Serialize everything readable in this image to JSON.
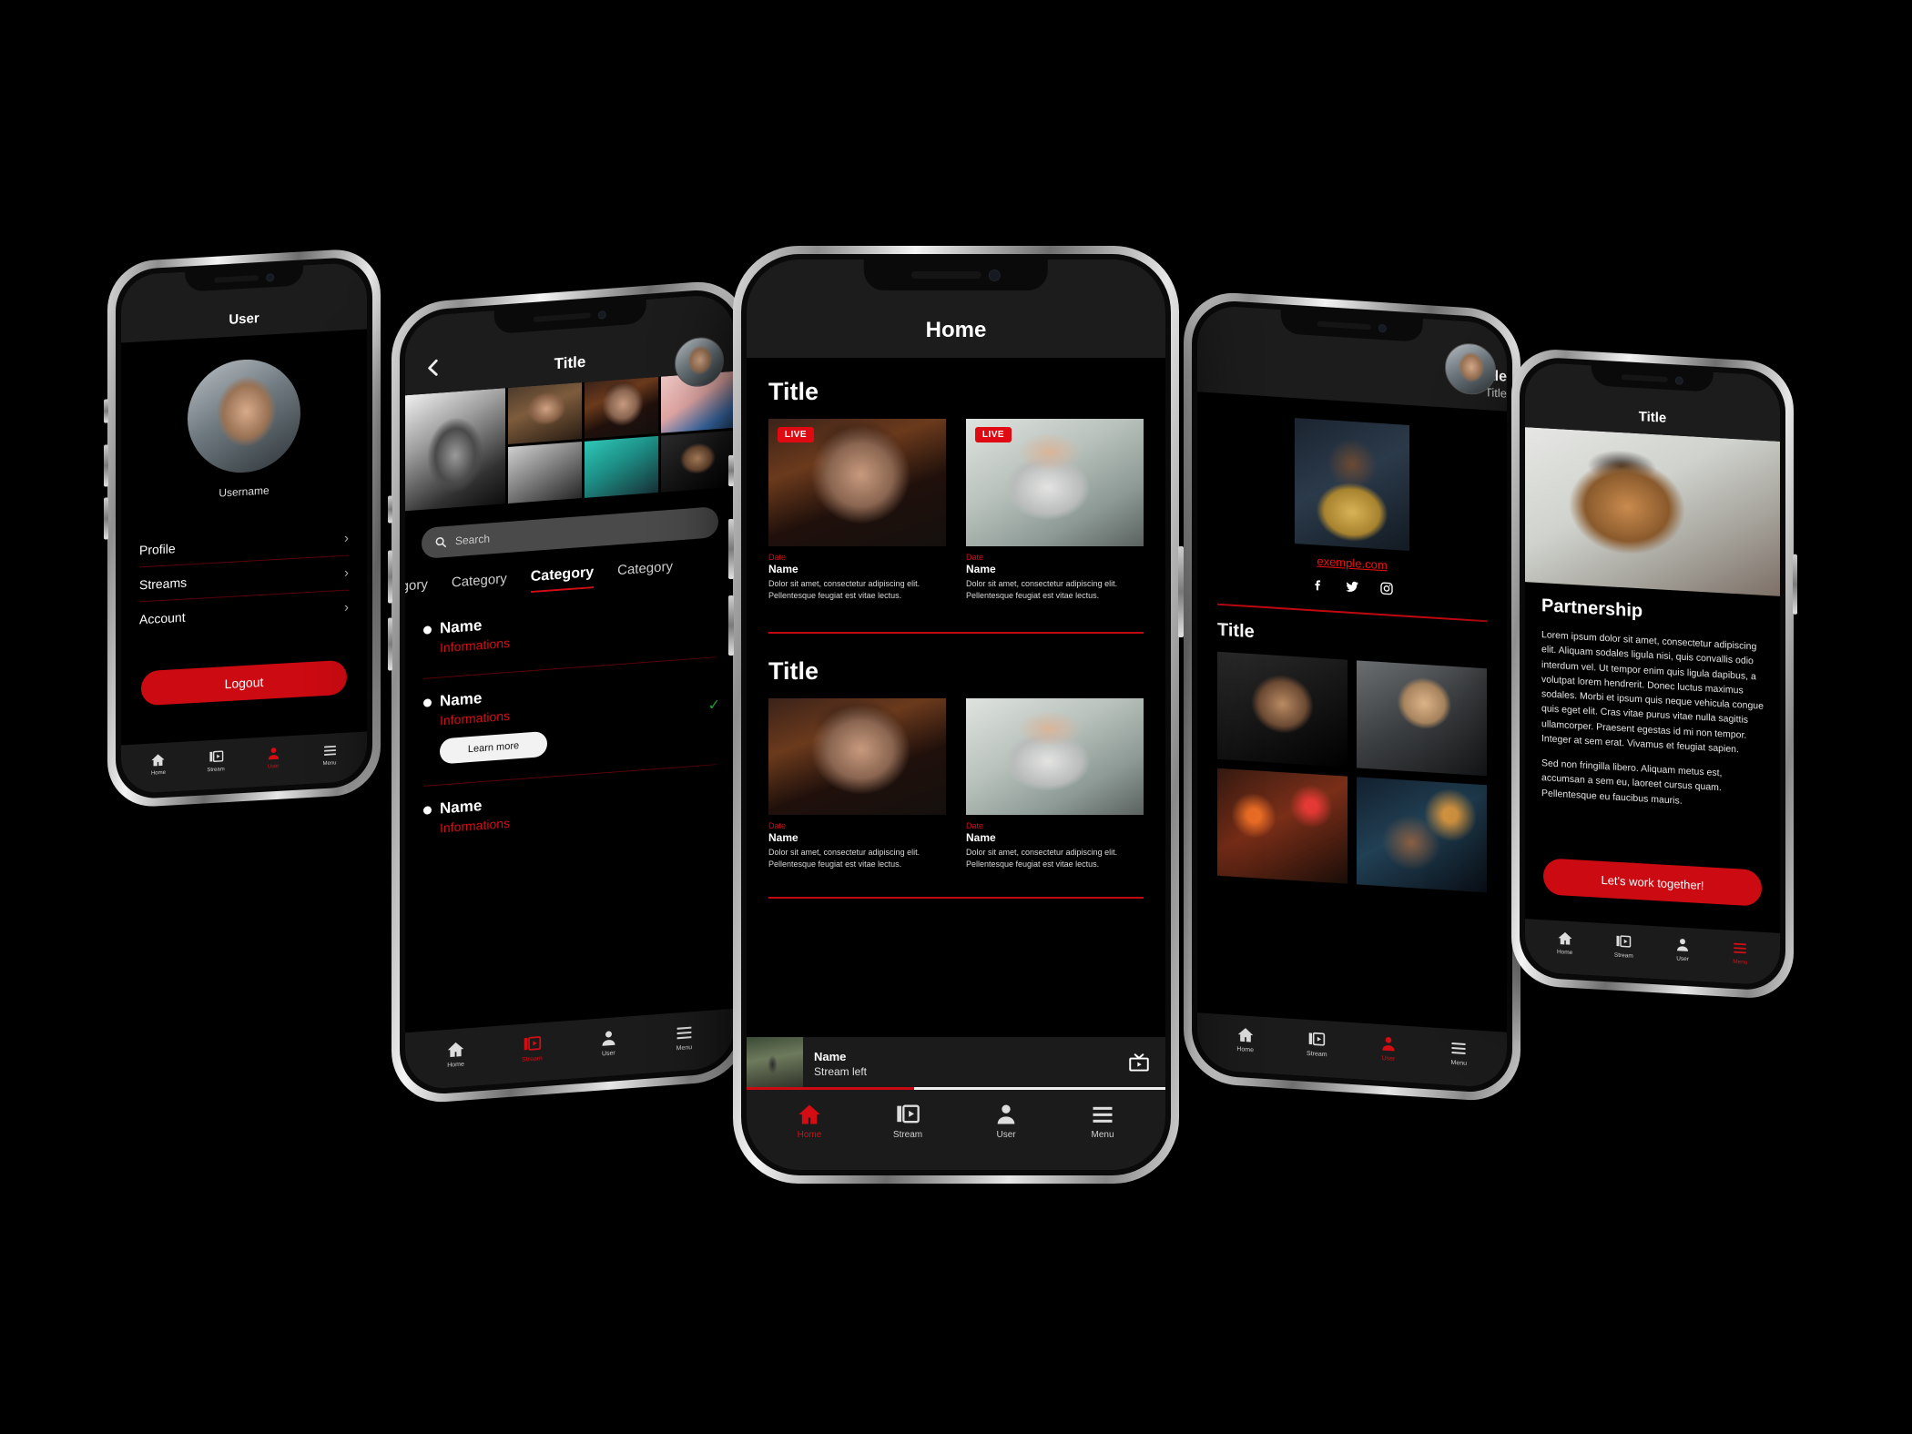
{
  "brand": {
    "accent": "#d40d15",
    "accent_dark": "#8b0009",
    "bg": "#000000",
    "surface": "#1c1c1c"
  },
  "phones": {
    "user": {
      "header_title": "User",
      "username": "Username",
      "menu_items": [
        {
          "label": "Profile",
          "chevron": "chevron-right-icon"
        },
        {
          "label": "Streams",
          "chevron": "chevron-right-icon"
        },
        {
          "label": "Account",
          "chevron": "chevron-right-icon"
        }
      ],
      "logout_label": "Logout",
      "tabs": [
        {
          "label": "Home",
          "icon": "home-icon",
          "active": false
        },
        {
          "label": "Stream",
          "icon": "stream-icon",
          "active": false
        },
        {
          "label": "User",
          "icon": "user-icon",
          "active": true
        },
        {
          "label": "Menu",
          "icon": "menu-icon",
          "active": false
        }
      ]
    },
    "category": {
      "header_title": "Title",
      "back_icon": "chevron-left-icon",
      "search_placeholder": "Search",
      "search_value": "",
      "search_icon": "search-icon",
      "tabs": [
        {
          "label": "Category",
          "active": false
        },
        {
          "label": "Category",
          "active": false
        },
        {
          "label": "Category",
          "active": true
        },
        {
          "label": "Category",
          "active": false
        }
      ],
      "list": [
        {
          "name": "Name",
          "info": "Informations",
          "has_button": false,
          "button_label": ""
        },
        {
          "name": "Name",
          "info": "Informations",
          "has_button": true,
          "button_label": "Learn more"
        },
        {
          "name": "Name",
          "info": "Informations",
          "has_button": false,
          "button_label": ""
        }
      ],
      "tabs_bottom": [
        {
          "label": "Home",
          "icon": "home-icon",
          "active": false
        },
        {
          "label": "Stream",
          "icon": "stream-icon",
          "active": true
        },
        {
          "label": "User",
          "icon": "user-icon",
          "active": false
        },
        {
          "label": "Menu",
          "icon": "menu-icon",
          "active": false
        }
      ]
    },
    "home": {
      "header_title": "Home",
      "sections": [
        {
          "title": "Title",
          "cards": [
            {
              "live": "LIVE",
              "is_live": true,
              "date": "Date",
              "name": "Name",
              "desc": "Dolor sit amet, consectetur adipiscing elit. Pellentesque feugiat est vitae lectus."
            },
            {
              "live": "LIVE",
              "is_live": true,
              "date": "Date",
              "name": "Name",
              "desc": "Dolor sit amet, consectetur adipiscing elit. Pellentesque feugiat est vitae lectus."
            }
          ]
        },
        {
          "title": "Title",
          "cards": [
            {
              "live": "",
              "is_live": false,
              "date": "Date",
              "name": "Name",
              "desc": "Dolor sit amet, consectetur adipiscing elit. Pellentesque feugiat est vitae lectus."
            },
            {
              "live": "",
              "is_live": false,
              "date": "Date",
              "name": "Name",
              "desc": "Dolor sit amet, consectetur adipiscing elit. Pellentesque feugiat est vitae lectus."
            }
          ]
        }
      ],
      "miniplayer": {
        "name": "Name",
        "subtitle": "Stream left",
        "cast_icon": "tv-cast-icon",
        "progress_percent": 40
      },
      "tabs": [
        {
          "label": "Home",
          "icon": "home-icon",
          "active": true
        },
        {
          "label": "Stream",
          "icon": "stream-icon",
          "active": false
        },
        {
          "label": "User",
          "icon": "user-icon",
          "active": false
        },
        {
          "label": "Menu",
          "icon": "menu-icon",
          "active": false
        }
      ]
    },
    "profile": {
      "header_title": "Title",
      "header_subtitle": "Title",
      "link": "exemple.com",
      "socials": [
        {
          "name": "facebook-icon"
        },
        {
          "name": "twitter-icon"
        },
        {
          "name": "instagram-icon"
        }
      ],
      "gallery_title": "Title",
      "tabs": [
        {
          "label": "Home",
          "icon": "home-icon",
          "active": false
        },
        {
          "label": "Stream",
          "icon": "stream-icon",
          "active": false
        },
        {
          "label": "User",
          "icon": "user-icon",
          "active": true
        },
        {
          "label": "Menu",
          "icon": "menu-icon",
          "active": false
        }
      ]
    },
    "partnership": {
      "header_title": "Title",
      "section_title": "Partnership",
      "paragraph_1": "Lorem ipsum dolor sit amet, consectetur adipiscing elit. Aliquam sodales ligula nisi, quis convallis odio interdum vel. Ut tempor enim quis ligula dapibus, a volutpat lorem hendrerit. Donec luctus maximus sodales. Morbi et ipsum quis neque vehicula congue quis eget elit. Cras vitae purus vitae nulla sagittis ullamcorper. Praesent egestas id mi non tempor. Integer at sem erat. Vivamus et feugiat sapien.",
      "paragraph_2": "Sed non fringilla libero. Aliquam metus est, accumsan a sem eu, laoreet cursus quam. Pellentesque eu faucibus mauris.",
      "cta_label": "Let's work together!",
      "tabs": [
        {
          "label": "Home",
          "icon": "home-icon",
          "active": false
        },
        {
          "label": "Stream",
          "icon": "stream-icon",
          "active": false
        },
        {
          "label": "User",
          "icon": "user-icon",
          "active": false
        },
        {
          "label": "Menu",
          "icon": "menu-icon",
          "active": true
        }
      ]
    }
  }
}
